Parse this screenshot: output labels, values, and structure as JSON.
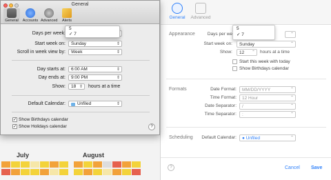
{
  "prefs_window": {
    "title": "General",
    "toolbar": [
      {
        "label": "General",
        "icon": "gear-switch-icon"
      },
      {
        "label": "Accounts",
        "icon": "at-icon"
      },
      {
        "label": "Advanced",
        "icon": "gear-icon"
      },
      {
        "label": "Alerts",
        "icon": "megaphone-icon"
      }
    ],
    "days_per_week": {
      "label": "Days per week:",
      "menu": [
        "5",
        "✓ 7"
      ]
    },
    "start_week_on": {
      "label": "Start week on:",
      "value": "Sunday"
    },
    "scroll_week_by": {
      "label": "Scroll in week view by:",
      "value": "Week"
    },
    "day_starts_at": {
      "label": "Day starts at:",
      "value": "6:00 AM"
    },
    "day_ends_at": {
      "label": "Day ends at:",
      "value": "9:00 PM"
    },
    "show_hours": {
      "label": "Show:",
      "value": "18",
      "suffix": "hours at a time"
    },
    "default_calendar": {
      "label": "Default Calendar:",
      "value": "Unfiled"
    },
    "show_birthdays": "Show Birthdays calendar",
    "show_holidays": "Show Holidays calendar",
    "help": "?"
  },
  "right_panel": {
    "tabs": [
      {
        "label": "General"
      },
      {
        "label": "Advanced"
      }
    ],
    "appearance": {
      "section": "Appearance",
      "days_per_week_label": "Days per we",
      "menu": [
        "5",
        "✓ 7"
      ],
      "start_week_label": "Start week on:",
      "start_week_value": "Sunday",
      "show_label": "Show:",
      "show_value": "12",
      "show_suffix": "hours at a time",
      "start_today": "Start this week with today",
      "show_birthdays": "Show Birthdays calendar"
    },
    "formats": {
      "section": "Formats",
      "date_format_label": "Date Format:",
      "date_format_value": "MM/DD/YYYY",
      "time_format_label": "Time Format:",
      "time_format_value": "12 Hour",
      "date_sep_label": "Date Separator:",
      "date_sep_value": "/",
      "time_sep_label": "Time Separator:",
      "time_sep_value": ":"
    },
    "scheduling": {
      "section": "Scheduling",
      "default_cal_label": "Default Calendar:",
      "default_cal_value": "● Unfiled"
    },
    "footer": {
      "help": "?",
      "cancel": "Cancel",
      "save": "Save"
    }
  },
  "background_calendar": {
    "months": [
      "July",
      "August"
    ]
  },
  "colors": {
    "accent_blue": "#2d7ff9",
    "cal_orange": "#f2a23a",
    "cal_yellow": "#f3d33a",
    "cal_red": "#e6614e"
  }
}
